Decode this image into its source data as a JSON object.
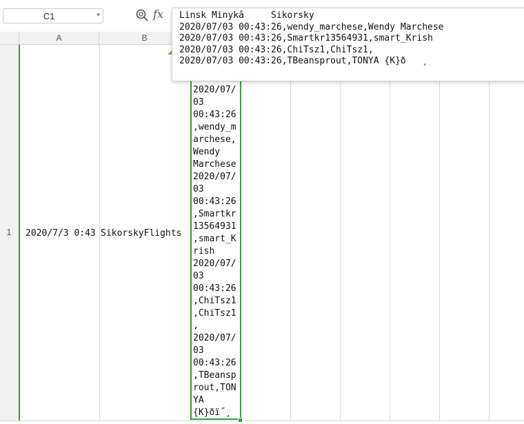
{
  "formula_bar": {
    "name_box": "C1",
    "fx_label": "fx",
    "zoom_icon": "zoom-formula-icon",
    "popup_lines": [
      "Linsk Minykâ     Sikorsky",
      "2020/07/03 00:43:26,wendy_marchese,Wendy Marchese",
      "2020/07/03 00:43:26,Smartkr13564931,smart_Krish",
      "2020/07/03 00:43:26,ChiTsz1,ChiTsz1,",
      "2020/07/03 00:43:26,TBeansprout,TONYA {K}ð   ¸"
    ]
  },
  "columns": [
    "A",
    "B"
  ],
  "row_number": "1",
  "cells": {
    "A1": "2020/7/3 0:43",
    "B1": "SikorskyFlights",
    "C1_lines": [
      "2020/07/",
      "03",
      "00:43:26",
      ",wendy_m",
      "archese,",
      "Wendy",
      "Marchese",
      "2020/07/",
      "03",
      "00:43:26",
      ",Smartkr",
      "13564931",
      ",smart_K",
      "rish",
      "2020/07/",
      "03",
      "00:43:26",
      ",ChiTsz1",
      ",ChiTsz1",
      ",",
      "2020/07/",
      "03",
      "00:43:26",
      ",TBeansp",
      "rout,TON",
      "YA",
      "{K}ðï˝¸"
    ]
  },
  "colors": {
    "selection": "#3c9a3c",
    "header_bg": "#f2f2f2",
    "grid": "#d9d9d9"
  }
}
